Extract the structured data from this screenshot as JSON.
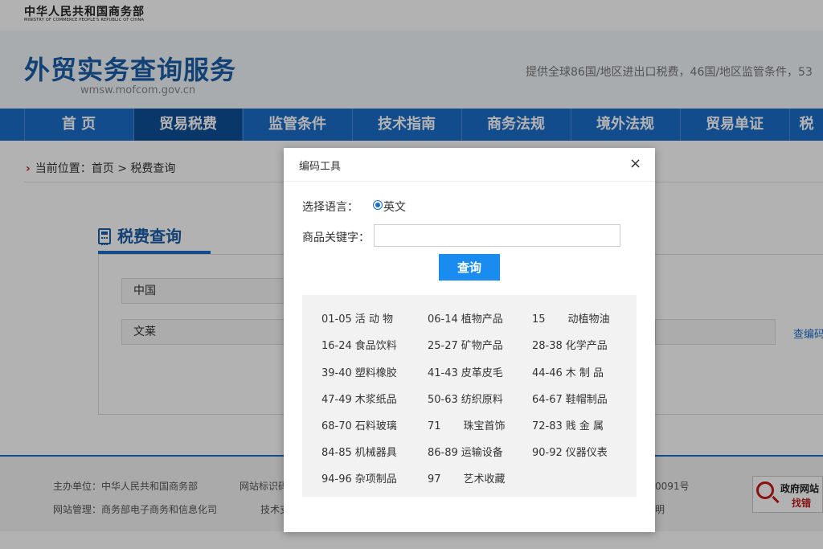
{
  "top": {
    "ministry_cn": "中华人民共和国商务部",
    "ministry_en": "MINISTRY OF COMMERCE PEOPLE'S REPUBLIC OF CHINA"
  },
  "header": {
    "site_title": "外贸实务查询服务",
    "site_domain": "wmsw.mofcom.gov.cn",
    "intro": "提供全球86国/地区进出口税费，46国/地区监管条件，53"
  },
  "nav": {
    "items": [
      "首 页",
      "贸易税费",
      "监管条件",
      "技术指南",
      "商务法规",
      "境外法规",
      "贸易单证",
      "税"
    ],
    "active_index": 1
  },
  "breadcrumb": {
    "text": "当前位置：首页 > 税费查询"
  },
  "panel": {
    "title": "税费查询",
    "country_value": "中国",
    "product_value": "文莱",
    "hs_link": "查编码"
  },
  "footer": {
    "sponsor": "主办单位：中华人民共和国商务部",
    "site_id": "网站标识码",
    "admin": "网站管理：商务部电子商务和信息化司",
    "tech": "技术支",
    "icp": "0091号",
    "statement": "明",
    "gov_badge_line1": "政府网站",
    "gov_badge_line2": "找错"
  },
  "modal": {
    "title": "编码工具",
    "close": "×",
    "lang_label": "选择语言：",
    "lang_option": "英文",
    "keyword_label": "商品关键字：",
    "keyword_value": "",
    "keyword_placeholder": "",
    "search_label": "查询",
    "categories": [
      {
        "code": "01-05",
        "name": "活 动 物"
      },
      {
        "code": "06-14",
        "name": "植物产品"
      },
      {
        "code": "15",
        "name": "动植物油"
      },
      {
        "code": "16-24",
        "name": "食品饮料"
      },
      {
        "code": "25-27",
        "name": "矿物产品"
      },
      {
        "code": "28-38",
        "name": "化学产品"
      },
      {
        "code": "39-40",
        "name": "塑料橡胶"
      },
      {
        "code": "41-43",
        "name": "皮革皮毛"
      },
      {
        "code": "44-46",
        "name": "木 制 品"
      },
      {
        "code": "47-49",
        "name": "木浆纸品"
      },
      {
        "code": "50-63",
        "name": "纺织原料"
      },
      {
        "code": "64-67",
        "name": "鞋帽制品"
      },
      {
        "code": "68-70",
        "name": "石料玻璃"
      },
      {
        "code": "71",
        "name": "珠宝首饰"
      },
      {
        "code": "72-83",
        "name": "贱 金 属"
      },
      {
        "code": "84-85",
        "name": "机械器具"
      },
      {
        "code": "86-89",
        "name": "运输设备"
      },
      {
        "code": "90-92",
        "name": "仪器仪表"
      },
      {
        "code": "94-96",
        "name": "杂项制品"
      },
      {
        "code": "97",
        "name": "艺术收藏"
      }
    ]
  }
}
